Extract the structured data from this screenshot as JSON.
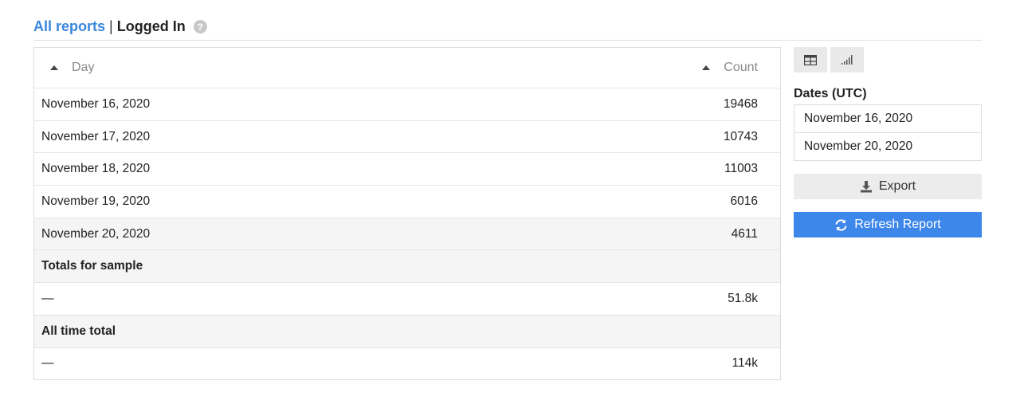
{
  "header": {
    "link": "All reports",
    "separator": "|",
    "title": "Logged In",
    "help": "?"
  },
  "table": {
    "columns": [
      "Day",
      "Count"
    ],
    "rows": [
      {
        "day": "November 16, 2020",
        "count": "19468"
      },
      {
        "day": "November 17, 2020",
        "count": "10743"
      },
      {
        "day": "November 18, 2020",
        "count": "11003"
      },
      {
        "day": "November 19, 2020",
        "count": "6016"
      },
      {
        "day": "November 20, 2020",
        "count": "4611"
      }
    ],
    "sample_total_label": "Totals for sample",
    "sample_total": {
      "day": "—",
      "count": "51.8k"
    },
    "all_time_label": "All time total",
    "all_time": {
      "day": "—",
      "count": "114k"
    }
  },
  "side": {
    "dates_label": "Dates (UTC)",
    "start_date": "November 16, 2020",
    "end_date": "November 20, 2020",
    "export_label": "Export",
    "refresh_label": "Refresh Report"
  },
  "icons": {
    "table_view": "table-view-icon",
    "chart_view": "bar-chart-icon",
    "export": "download-icon",
    "refresh": "refresh-icon"
  },
  "colors": {
    "link": "#3a86e0",
    "primary_button": "#3d86ea"
  }
}
